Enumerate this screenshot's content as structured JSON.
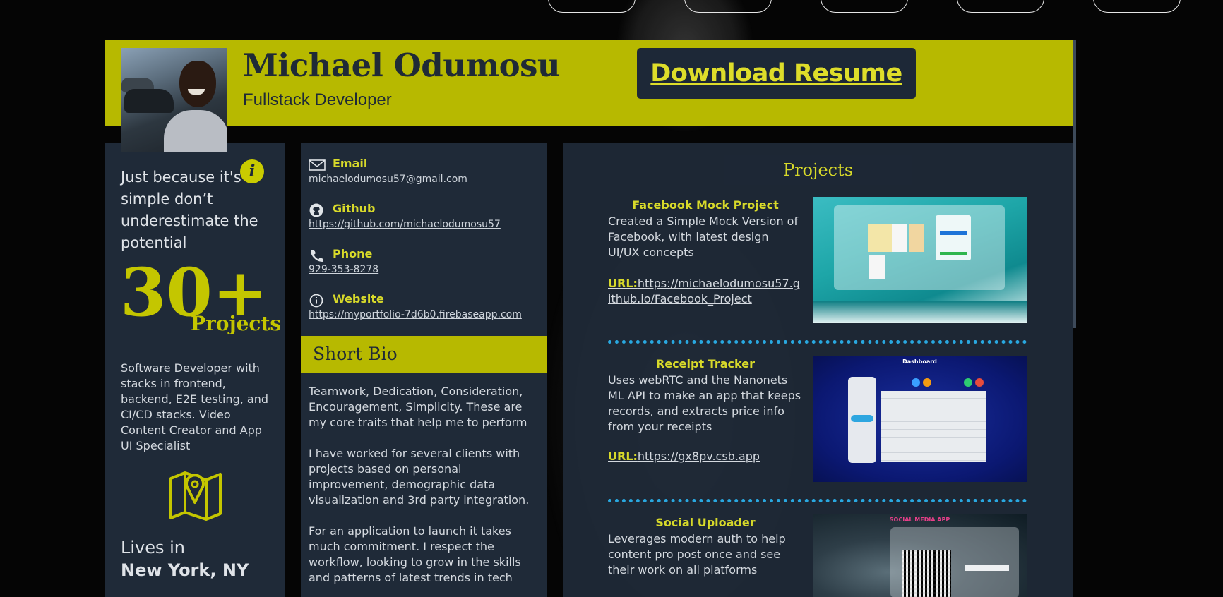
{
  "header": {
    "name": "Michael Odumosu",
    "role": "Fullstack Developer",
    "download_label": "Download Resume"
  },
  "left": {
    "quote": "Just because it's simple don’t underestimate the potential",
    "count": "30+",
    "count_label": "Projects",
    "summary": "Software Developer with stacks in frontend, backend, E2E testing, and CI/CD stacks. Video Content Creator and App UI Specialist",
    "lives_label": "Lives in",
    "city": "New York, NY"
  },
  "contact": {
    "email_label": "Email",
    "email": "michaelodumosu57@gmail.com",
    "github_label": "Github",
    "github": "https://github.com/michaelodumosu57",
    "phone_label": "Phone",
    "phone": "929-353-8278",
    "website_label": "Website",
    "website": "https://myportfolio-7d6b0.firebaseapp.com"
  },
  "bio": {
    "title": "Short Bio",
    "p1": "Teamwork, Dedication, Consideration, Encouragement, Simplicity. These are my core traits that help me to perform",
    "p2": "I have worked for several clients with projects based on personal improvement, demographic data visualization and 3rd party integration.",
    "p3": "For an application to launch it takes much commitment. I respect the workflow, looking to grow in the skills and patterns of latest trends in tech"
  },
  "projects": {
    "title": "Projects",
    "url_prefix": "URL:",
    "items": [
      {
        "title": "Facebook Mock Project",
        "desc": "Created a Simple Mock Version of Facebook, with latest design UI/UX concepts",
        "url": "https://michaelodumosu57.github.io/Facebook_Project"
      },
      {
        "title": "Receipt Tracker",
        "desc": "Uses webRTC and the Nanonets ML API to make an app that keeps records, and extracts price info from your receipts",
        "url": "https://gx8pv.csb.app"
      },
      {
        "title": "Social Uploader",
        "desc": "Leverages modern auth to help content pro post once and see their work on all platforms",
        "url": ""
      }
    ],
    "shot_labels": {
      "dashboard": "Dashboard",
      "social": "SOCIAL MEDIA APP"
    }
  },
  "colors": {
    "accent": "#b7b900",
    "accent_text": "#d7d92a",
    "panel": "#1f2a38",
    "divider": "#29a8e0"
  }
}
